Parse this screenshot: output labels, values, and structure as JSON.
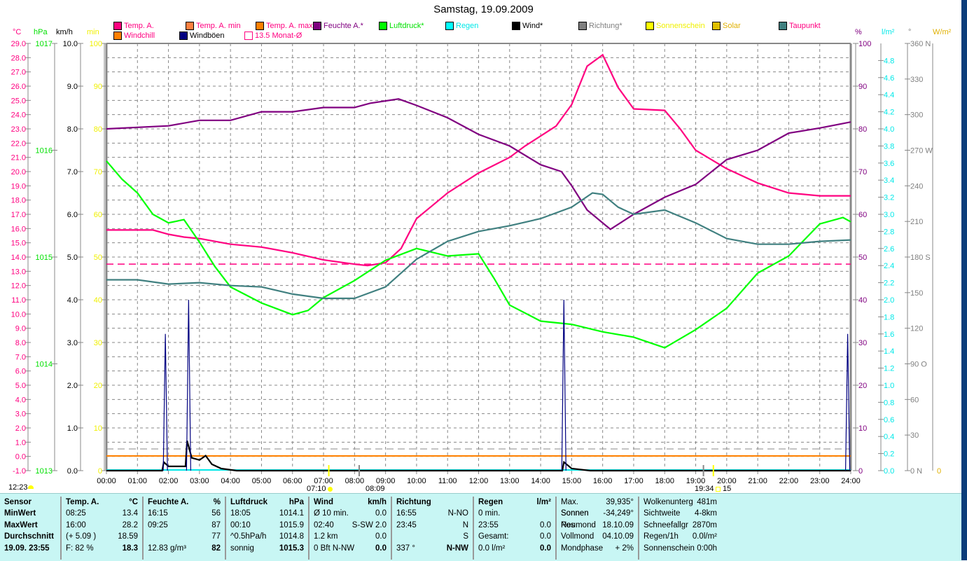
{
  "chart_data": {
    "type": "line",
    "title": "Samstag, 19.09.2009",
    "xlabel": "",
    "x_ticks": [
      "00:00",
      "01:00",
      "02:00",
      "03:00",
      "04:00",
      "05:00",
      "06:00",
      "07:00",
      "08:00",
      "09:00",
      "10:00",
      "11:00",
      "12:00",
      "13:00",
      "14:00",
      "15:00",
      "16:00",
      "17:00",
      "18:00",
      "19:00",
      "20:00",
      "21:00",
      "22:00",
      "23:00",
      "24:00"
    ],
    "xlim": [
      0,
      24
    ],
    "grid": true,
    "legend": [
      {
        "label": "Temp. A.",
        "color": "#ff0080",
        "text_color": "#ff0080"
      },
      {
        "label": "Temp. A. min",
        "color": "#ff8040",
        "text_color": "#ff0080"
      },
      {
        "label": "Temp. A. max",
        "color": "#ff8000",
        "text_color": "#ff0080"
      },
      {
        "label": "Feuchte A.*",
        "color": "#800080",
        "text_color": "#800080"
      },
      {
        "label": "Luftdruck*",
        "color": "#00ff00",
        "text_color": "#00e000"
      },
      {
        "label": "Regen",
        "color": "#00ffff",
        "text_color": "#00e8e8"
      },
      {
        "label": "Wind*",
        "color": "#000000",
        "text_color": "#000000"
      },
      {
        "label": "Richtung*",
        "color": "#808080",
        "text_color": "#808080"
      },
      {
        "label": "Sonnenschein",
        "color": "#ffff00",
        "text_color": "#f0f000"
      },
      {
        "label": "Solar",
        "color": "#e0c000",
        "text_color": "#e0b000"
      },
      {
        "label": "Taupunkt",
        "color": "#408080",
        "text_color": "#ff0080"
      },
      {
        "label": "Windchill",
        "color": "#ff8000",
        "text_color": "#ff0080"
      },
      {
        "label": "Windböen",
        "color": "#000080",
        "text_color": "#000000"
      },
      {
        "label": "13.5 Monat-Ø",
        "color": "#ff0080",
        "text_color": "#ff0080"
      }
    ],
    "axes": {
      "temp": {
        "unit": "°C",
        "range": [
          -1,
          29
        ],
        "step": 1,
        "color": "#ff0080"
      },
      "pressure": {
        "unit": "hPa",
        "range": [
          1013,
          1017
        ],
        "step": 1,
        "color": "#00e000"
      },
      "wind": {
        "unit": "km/h",
        "range": [
          0,
          10
        ],
        "step": 1,
        "color": "#000000"
      },
      "min": {
        "unit": "min",
        "range": [
          0,
          100
        ],
        "step": 10,
        "color": "#f0f000"
      },
      "humidity": {
        "unit": "%",
        "range": [
          0,
          100
        ],
        "step": 10,
        "color": "#800080"
      },
      "rain": {
        "unit": "l/m²",
        "range": [
          0,
          5
        ],
        "step": 0.2,
        "color": "#00e8e8"
      },
      "direction": {
        "unit": "°",
        "range": [
          0,
          360
        ],
        "step": 30,
        "color": "#808080",
        "compass": {
          "0": "N",
          "90": "O",
          "180": "S",
          "270": "W",
          "360": "N"
        }
      },
      "solar": {
        "unit": "W/m²",
        "range": [
          0,
          0
        ],
        "color": "#e0b000"
      }
    },
    "series": [
      {
        "name": "Temp. A.",
        "axis": "temp",
        "color": "#ff0080",
        "points": [
          [
            0,
            15.9
          ],
          [
            1,
            15.9
          ],
          [
            1.5,
            15.9
          ],
          [
            2,
            15.6
          ],
          [
            2.5,
            15.4
          ],
          [
            3,
            15.3
          ],
          [
            4,
            14.9
          ],
          [
            5,
            14.7
          ],
          [
            6,
            14.3
          ],
          [
            7,
            13.8
          ],
          [
            8,
            13.5
          ],
          [
            8.42,
            13.4
          ],
          [
            9,
            13.6
          ],
          [
            9.5,
            14.6
          ],
          [
            10,
            16.7
          ],
          [
            10.5,
            17.6
          ],
          [
            11,
            18.5
          ],
          [
            12,
            19.9
          ],
          [
            13,
            21.0
          ],
          [
            13.5,
            21.8
          ],
          [
            14,
            22.5
          ],
          [
            14.5,
            23.2
          ],
          [
            15,
            24.7
          ],
          [
            15.5,
            27.4
          ],
          [
            16,
            28.2
          ],
          [
            16.5,
            25.9
          ],
          [
            17,
            24.4
          ],
          [
            18,
            24.3
          ],
          [
            18.5,
            23.0
          ],
          [
            19,
            21.5
          ],
          [
            20,
            20.2
          ],
          [
            21,
            19.2
          ],
          [
            22,
            18.5
          ],
          [
            23,
            18.3
          ],
          [
            24,
            18.3
          ]
        ]
      },
      {
        "name": "Feuchte A.*",
        "axis": "humidity",
        "color": "#800080",
        "points": [
          [
            0,
            80
          ],
          [
            2,
            80.7
          ],
          [
            3,
            82
          ],
          [
            4,
            82
          ],
          [
            5,
            84
          ],
          [
            6,
            84
          ],
          [
            7,
            85
          ],
          [
            8,
            85
          ],
          [
            8.5,
            86
          ],
          [
            9.42,
            87
          ],
          [
            10,
            85.5
          ],
          [
            11,
            82.6
          ],
          [
            12,
            78.7
          ],
          [
            13,
            76
          ],
          [
            14,
            71.6
          ],
          [
            14.67,
            70
          ],
          [
            15,
            66.7
          ],
          [
            15.5,
            61
          ],
          [
            16.25,
            56.5
          ],
          [
            17,
            60
          ],
          [
            18,
            64
          ],
          [
            19,
            67
          ],
          [
            20,
            72.8
          ],
          [
            21,
            75
          ],
          [
            22,
            79
          ],
          [
            23,
            80.2
          ],
          [
            24,
            81.6
          ]
        ]
      },
      {
        "name": "Luftdruck*",
        "axis": "pressure",
        "color": "#00ff00",
        "points": [
          [
            0,
            1015.9
          ],
          [
            0.5,
            1015.73
          ],
          [
            1,
            1015.6
          ],
          [
            1.5,
            1015.4
          ],
          [
            2,
            1015.32
          ],
          [
            2.5,
            1015.35
          ],
          [
            3,
            1015.14
          ],
          [
            3.5,
            1014.91
          ],
          [
            4,
            1014.72
          ],
          [
            5,
            1014.57
          ],
          [
            6,
            1014.46
          ],
          [
            6.5,
            1014.5
          ],
          [
            7,
            1014.62
          ],
          [
            8,
            1014.78
          ],
          [
            9,
            1014.97
          ],
          [
            10,
            1015.08
          ],
          [
            11,
            1015.01
          ],
          [
            12,
            1015.03
          ],
          [
            12.5,
            1014.8
          ],
          [
            13,
            1014.55
          ],
          [
            14,
            1014.4
          ],
          [
            15,
            1014.37
          ],
          [
            16,
            1014.3
          ],
          [
            17,
            1014.25
          ],
          [
            18,
            1014.15
          ],
          [
            19,
            1014.32
          ],
          [
            20,
            1014.52
          ],
          [
            21,
            1014.85
          ],
          [
            22,
            1015.01
          ],
          [
            23,
            1015.31
          ],
          [
            23.75,
            1015.37
          ],
          [
            24,
            1015.33
          ]
        ]
      },
      {
        "name": "Taupunkt",
        "axis": "temp",
        "color": "#408080",
        "points": [
          [
            0,
            12.4
          ],
          [
            1,
            12.4
          ],
          [
            2,
            12.1
          ],
          [
            3,
            12.2
          ],
          [
            4,
            12.0
          ],
          [
            5,
            11.9
          ],
          [
            6,
            11.4
          ],
          [
            7,
            11.1
          ],
          [
            8,
            11.1
          ],
          [
            9,
            11.9
          ],
          [
            10,
            13.85
          ],
          [
            11,
            15.1
          ],
          [
            12,
            15.8
          ],
          [
            13,
            16.2
          ],
          [
            14,
            16.7
          ],
          [
            15,
            17.5
          ],
          [
            15.67,
            18.5
          ],
          [
            16,
            18.4
          ],
          [
            16.5,
            17.5
          ],
          [
            17,
            17.0
          ],
          [
            18,
            17.3
          ],
          [
            19,
            16.4
          ],
          [
            20,
            15.3
          ],
          [
            21,
            14.9
          ],
          [
            22,
            14.9
          ],
          [
            23,
            15.1
          ],
          [
            24,
            15.2
          ]
        ]
      },
      {
        "name": "Wind*",
        "axis": "wind",
        "color": "#000000",
        "points": [
          [
            0,
            0
          ],
          [
            1.8,
            0
          ],
          [
            1.85,
            0.2
          ],
          [
            2,
            0.1
          ],
          [
            2.55,
            0.1
          ],
          [
            2.6,
            0.7
          ],
          [
            2.75,
            0.3
          ],
          [
            3,
            0.25
          ],
          [
            3.2,
            0.35
          ],
          [
            3.4,
            0.15
          ],
          [
            3.7,
            0.05
          ],
          [
            4.2,
            0
          ],
          [
            14.7,
            0
          ],
          [
            14.75,
            0.2
          ],
          [
            15,
            0.05
          ],
          [
            15.6,
            0
          ],
          [
            24,
            0
          ]
        ]
      },
      {
        "name": "Windböen",
        "axis": "wind",
        "color": "#000080",
        "type": "spikes",
        "points": [
          [
            1.9,
            3.2
          ],
          [
            2.65,
            4.0
          ],
          [
            14.75,
            4.0
          ],
          [
            23.9,
            3.2
          ]
        ]
      },
      {
        "name": "Windchill",
        "axis": "temp",
        "color": "#ff8000",
        "constant": 0.03
      },
      {
        "name": "13.5 Monat-Ø",
        "axis": "temp",
        "color": "#ff0080",
        "constant": 13.5,
        "dashed": true
      }
    ],
    "annotations": {
      "current_time": "12:23",
      "sunrise": "07:10",
      "transit": "08:09",
      "sunset": "19:34",
      "sunset_suffix": "15"
    }
  },
  "table": {
    "sections": [
      {
        "rows": [
          [
            "Sensor",
            ""
          ],
          [
            "MinWert",
            ""
          ],
          [
            "MaxWert",
            ""
          ],
          [
            "Durchschnitt",
            ""
          ],
          [
            "19.09. 23:55",
            ""
          ]
        ]
      },
      {
        "rows": [
          [
            "Temp. A.",
            "°C"
          ],
          [
            "08:25",
            "13.4"
          ],
          [
            "16:00",
            "28.2"
          ],
          [
            "(+ 5.09 )",
            "18.59"
          ],
          [
            "F: 82 %",
            "18.3"
          ]
        ]
      },
      {
        "rows": [
          [
            "Feuchte A.",
            "%"
          ],
          [
            "16:15",
            "56"
          ],
          [
            "09:25",
            "87"
          ],
          [
            "",
            "77"
          ],
          [
            "12.83 g/m³",
            "82"
          ]
        ]
      },
      {
        "rows": [
          [
            "Luftdruck",
            "hPa"
          ],
          [
            "18:05",
            "1014.1"
          ],
          [
            "00:10",
            "1015.9"
          ],
          [
            "^0.5hPa/h",
            "1014.8"
          ],
          [
            "sonnig",
            "1015.3"
          ]
        ]
      },
      {
        "rows": [
          [
            "Wind",
            "km/h"
          ],
          [
            "Ø 10 min.",
            "0.0"
          ],
          [
            "02:40",
            "S-SW 2.0"
          ],
          [
            "1.2 km",
            "0.0"
          ],
          [
            "0 Bft N-NW",
            "0.0"
          ]
        ]
      },
      {
        "rows": [
          [
            "Richtung",
            ""
          ],
          [
            "16:55",
            "N-NO"
          ],
          [
            "23:45",
            "N"
          ],
          [
            "",
            "S"
          ],
          [
            "337 °",
            "N-NW"
          ]
        ]
      },
      {
        "rows": [
          [
            "Regen",
            "l/m²"
          ],
          [
            "0 min.",
            ""
          ],
          [
            "23:55",
            "0.0"
          ],
          [
            "Gesamt:",
            "0.0"
          ],
          [
            "0.0 l/m²",
            "0.0"
          ]
        ]
      },
      {
        "rows": [
          [
            "Max. Sonnen",
            "39,935°"
          ],
          [
            "Sonnen Pos",
            "-34,249°"
          ],
          [
            "Neumond",
            "18.10.09"
          ],
          [
            "Vollmond",
            "04.10.09"
          ],
          [
            "Mondphase",
            "+ 2%"
          ]
        ]
      },
      {
        "rows": [
          [
            "Wolkenunterg",
            "481m"
          ],
          [
            "Sichtweite",
            "4-8km"
          ],
          [
            "Schneefallgr",
            "2870m"
          ],
          [
            "Regen/1h",
            "0.0l/m²"
          ],
          [
            "Sonnenschein",
            "0:00h"
          ]
        ]
      }
    ]
  }
}
